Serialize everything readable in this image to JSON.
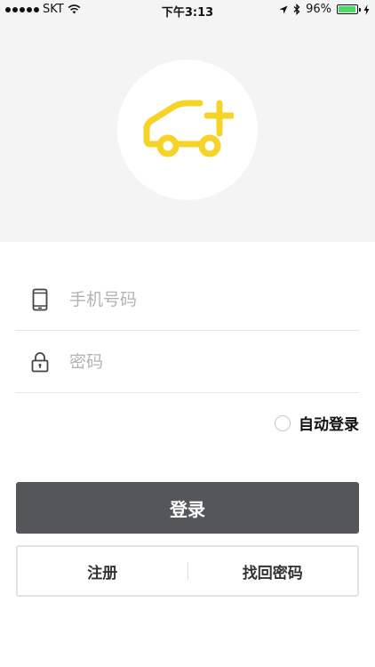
{
  "status_bar": {
    "carrier": "SKT",
    "time": "下午3:13",
    "battery_percent": "96%",
    "battery_level": 0.96,
    "battery_color": "#4cd964"
  },
  "hero": {
    "logo_icon": "car-plus-icon",
    "logo_color": "#f5d327",
    "background": "#f4f4f4"
  },
  "form": {
    "phone": {
      "placeholder": "手机号码",
      "value": "",
      "icon": "mobile-phone-icon"
    },
    "password": {
      "placeholder": "密码",
      "value": "",
      "icon": "lock-icon"
    },
    "auto_login_label": "自动登录",
    "auto_login_checked": false
  },
  "actions": {
    "login_label": "登录",
    "login_color": "#55565a",
    "register_label": "注册",
    "recover_label": "找回密码"
  }
}
